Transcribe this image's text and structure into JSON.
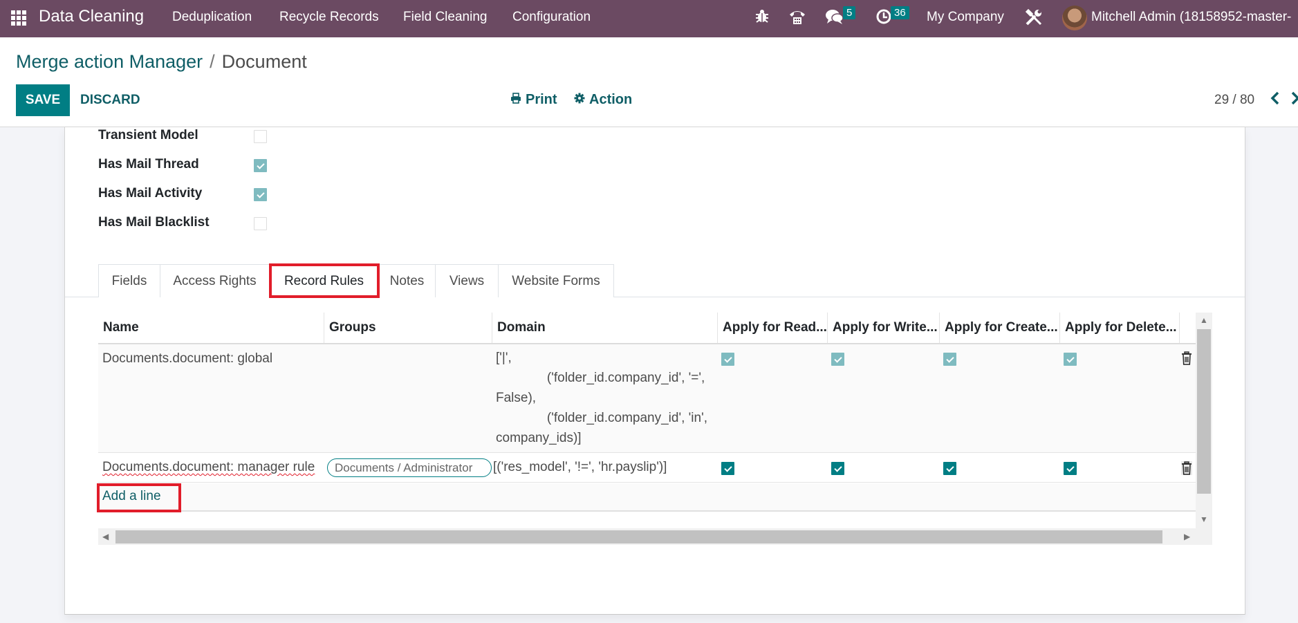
{
  "navbar": {
    "app_name": "Data Cleaning",
    "menus": [
      "Deduplication",
      "Recycle Records",
      "Field Cleaning",
      "Configuration"
    ],
    "icons": [
      "bug-icon",
      "phone-icon",
      "chat-icon",
      "clock-icon",
      "tools-icon"
    ],
    "messages_count": "5",
    "activities_count": "36",
    "company": "My Company",
    "user": "Mitchell Admin (18158952-master-"
  },
  "breadcrumb": {
    "parent": "Merge action Manager",
    "separator": "/",
    "current": "Document"
  },
  "toolbar": {
    "save_label": "SAVE",
    "discard_label": "DISCARD",
    "print_label": "Print",
    "action_label": "Action",
    "pager": "29 / 80"
  },
  "fields": [
    {
      "label": "Transient Model",
      "checked": false
    },
    {
      "label": "Has Mail Thread",
      "checked": true
    },
    {
      "label": "Has Mail Activity",
      "checked": true
    },
    {
      "label": "Has Mail Blacklist",
      "checked": false
    }
  ],
  "tabs": [
    {
      "label": "Fields",
      "active": false
    },
    {
      "label": "Access Rights",
      "active": false
    },
    {
      "label": "Record Rules",
      "active": true
    },
    {
      "label": "Notes",
      "active": false
    },
    {
      "label": "Views",
      "active": false
    },
    {
      "label": "Website Forms",
      "active": false
    }
  ],
  "record_rules": {
    "columns": [
      "Name",
      "Groups",
      "Domain",
      "Apply for Read...",
      "Apply for Write...",
      "Apply for Create...",
      "Apply for Delete..."
    ],
    "rows": [
      {
        "name": "Documents.document: global",
        "groups": "",
        "domain": "['|',\n              ('folder_id.company_id', '=',\nFalse),\n              ('folder_id.company_id', 'in',\ncompany_ids)]",
        "read": true,
        "write": true,
        "create": true,
        "delete": true
      },
      {
        "name": "Documents.document: manager rule",
        "groups": "Documents / Administrator",
        "domain": "[('res_model', '!=', 'hr.payslip')]",
        "read": true,
        "write": true,
        "create": true,
        "delete": true
      }
    ],
    "add_line_label": "Add a line"
  },
  "colors": {
    "navbar": "#6b4a62",
    "primary": "#017e84",
    "link": "#0f5e66",
    "highlight": "#e11d2a"
  }
}
